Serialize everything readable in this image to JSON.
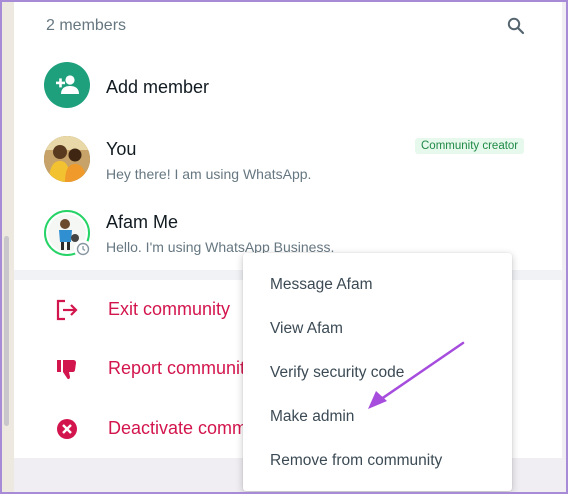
{
  "members": {
    "count_label": "2 members",
    "search_icon": "search-icon"
  },
  "add_member": {
    "label": "Add member",
    "icon": "add-person-icon",
    "color": "#1ea07c"
  },
  "member_list": [
    {
      "name": "You",
      "status": "Hey there! I am using WhatsApp.",
      "badge": "Community creator"
    },
    {
      "name": "Afam Me",
      "status": "Hello. I'm using WhatsApp Business."
    }
  ],
  "actions": [
    {
      "label": "Exit community",
      "icon": "exit-icon"
    },
    {
      "label": "Report community",
      "icon": "thumbs-down-icon"
    },
    {
      "label": "Deactivate community",
      "icon": "deactivate-icon"
    }
  ],
  "context_menu": {
    "items": [
      {
        "label": "Message Afam"
      },
      {
        "label": "View Afam"
      },
      {
        "label": "Verify security code"
      },
      {
        "label": "Make admin"
      },
      {
        "label": "Remove from community"
      }
    ]
  },
  "colors": {
    "accent": "#1ea07c",
    "danger": "#d3154d",
    "annotation": "#a64dde",
    "badge_bg": "#e7f8ec",
    "badge_text": "#1f8a46"
  }
}
